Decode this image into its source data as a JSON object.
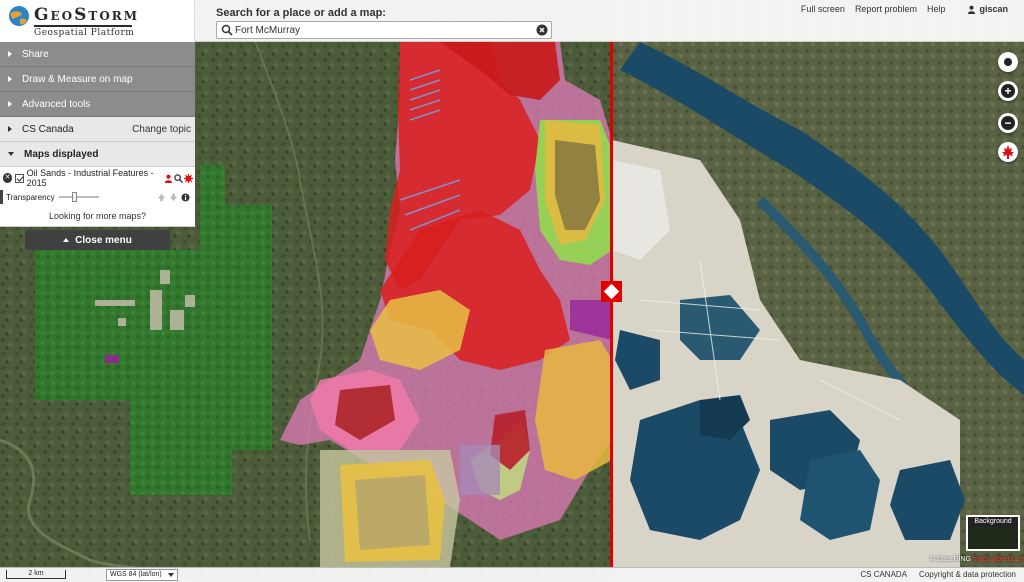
{
  "app": {
    "brand": "GeoStorm",
    "tagline": "Geospatial Platform"
  },
  "search": {
    "label": "Search for a place or add a map:",
    "value": "Fort McMurray",
    "placeholder": ""
  },
  "toplinks": {
    "fullscreen": "Full screen",
    "report": "Report problem",
    "help": "Help",
    "user": "giscan"
  },
  "menu": {
    "share": "Share",
    "draw": "Draw & Measure on map",
    "advanced": "Advanced tools",
    "topic": "CS Canada",
    "change_topic": "Change topic",
    "maps_displayed": "Maps displayed",
    "layer_name": "Oil Sands - Industrial Features - 2015",
    "transparency": "Transparency",
    "transparency_level": 0.38,
    "more_maps": "Looking for more maps?",
    "close": "Close menu"
  },
  "map": {
    "background_label": "Background",
    "attribution_prefix": "© Data BING",
    "attribution_link": "maps.alberta.ca"
  },
  "footer": {
    "scale": "2 km",
    "projection": "WGS 84 (lat/lon)",
    "org": "CS CANADA",
    "copyright": "Copyright & data protection"
  },
  "colors": {
    "swipe": "#e00000",
    "menu_dark": "#8c8c8c",
    "close_menu": "#404040"
  },
  "icons": {
    "zoom_in": "plus-icon",
    "zoom_out": "minus-icon",
    "locate": "locate-icon",
    "search": "search-icon"
  }
}
